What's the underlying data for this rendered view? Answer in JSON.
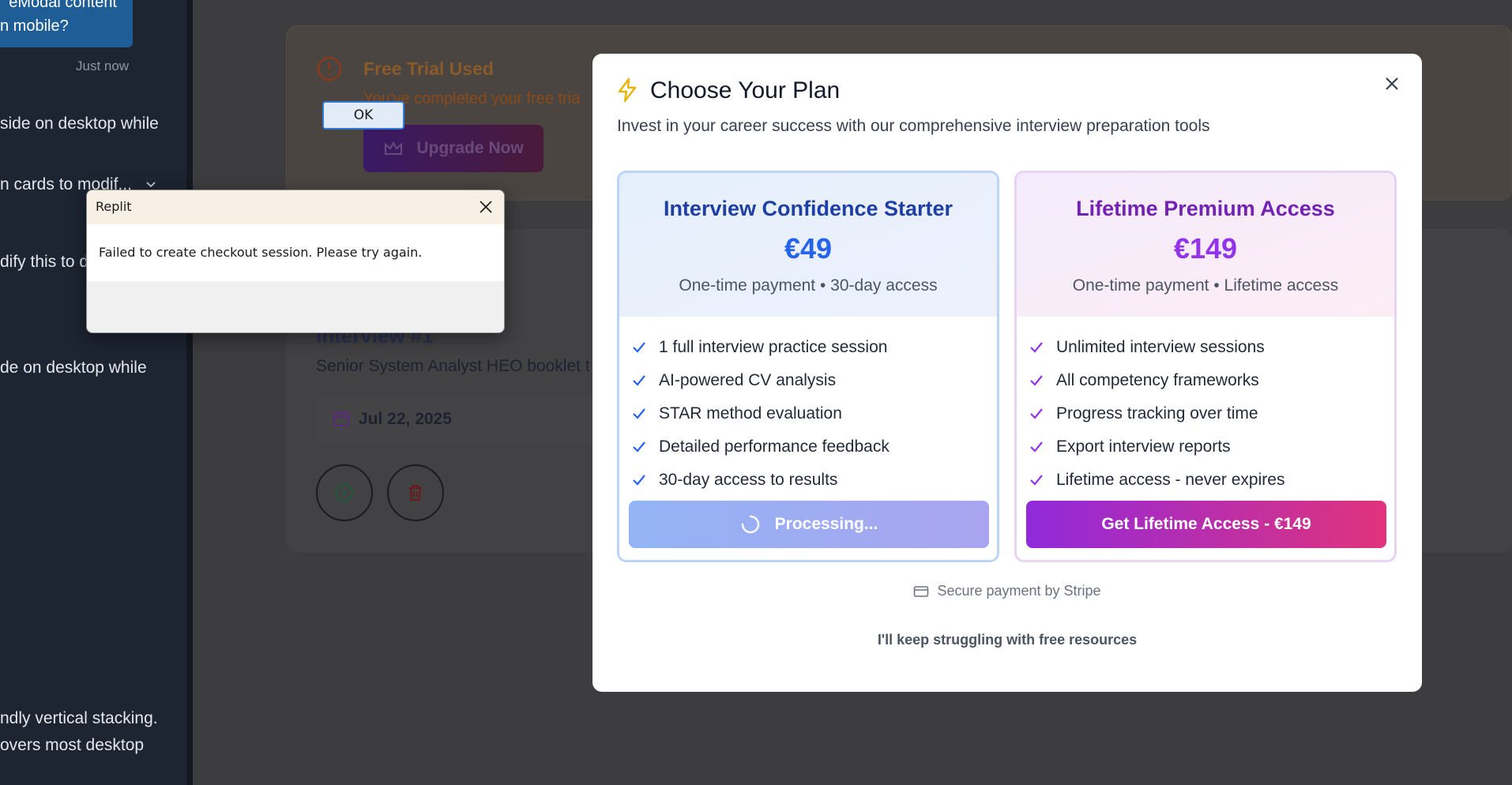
{
  "sidebar": {
    "bubble_line1": "eModal content",
    "bubble_line2": "n mobile?",
    "timestamp": "Just now",
    "lines": [
      "side on desktop while",
      "n cards to modif...",
      "dify this to d",
      "de on desktop while",
      "ndly vertical stacking.",
      "overs most desktop"
    ]
  },
  "background": {
    "trial_title": "Free Trial Used",
    "trial_sub": "You've completed your free tria",
    "upgrade_label": "Upgrade Now",
    "interview_title": "Interview #1",
    "interview_sub": "Senior System Analyst HEO booklet t",
    "date": "Jul 22, 2025"
  },
  "modal": {
    "title": "Choose Your Plan",
    "subtitle": "Invest in your career success with our comprehensive interview preparation tools",
    "plans": [
      {
        "name": "Interview Confidence Starter",
        "price": "€49",
        "terms": "One-time payment • 30-day access",
        "features": [
          "1 full interview practice session",
          "AI-powered CV analysis",
          "STAR method evaluation",
          "Detailed performance feedback",
          "30-day access to results"
        ],
        "button_label": "Processing...",
        "accent": "#2563eb"
      },
      {
        "name": "Lifetime Premium Access",
        "price": "€149",
        "terms": "One-time payment • Lifetime access",
        "features": [
          "Unlimited interview sessions",
          "All competency frameworks",
          "Progress tracking over time",
          "Export interview reports",
          "Lifetime access - never expires"
        ],
        "button_label": "Get Lifetime Access - €149",
        "accent": "#9333ea"
      }
    ],
    "secure_text": "Secure payment by Stripe",
    "decline_text": "I'll keep struggling with free resources"
  },
  "alert": {
    "title": "Replit",
    "message": "Failed to create checkout session. Please try again.",
    "ok_label": "OK"
  }
}
